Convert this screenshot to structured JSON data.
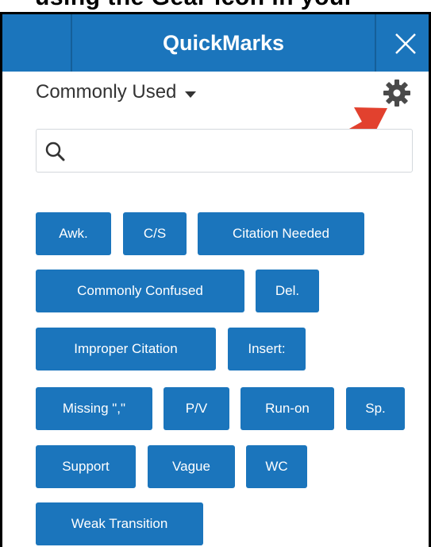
{
  "caption": {
    "text": "using the Gear icon in your"
  },
  "header": {
    "title": "QuickMarks"
  },
  "set_selector": {
    "label": "Commonly Used"
  },
  "search": {
    "value": "",
    "placeholder": ""
  },
  "quickmarks": [
    "Awk.",
    "C/S",
    "Citation Needed",
    "Commonly Confused",
    "Del.",
    "Improper Citation",
    "Insert:",
    "Missing \",\"",
    "P/V",
    "Run-on",
    "Sp.",
    "Support",
    "Vague",
    "WC",
    "Weak Transition"
  ],
  "colors": {
    "header_bg": "#1b75bc",
    "button_bg": "#1b75bc",
    "arrow": "#e2412e",
    "gear": "#4a4a4a"
  },
  "icons": [
    "close-icon",
    "chevron-down-icon",
    "gear-icon",
    "arrow-icon",
    "search-icon"
  ]
}
